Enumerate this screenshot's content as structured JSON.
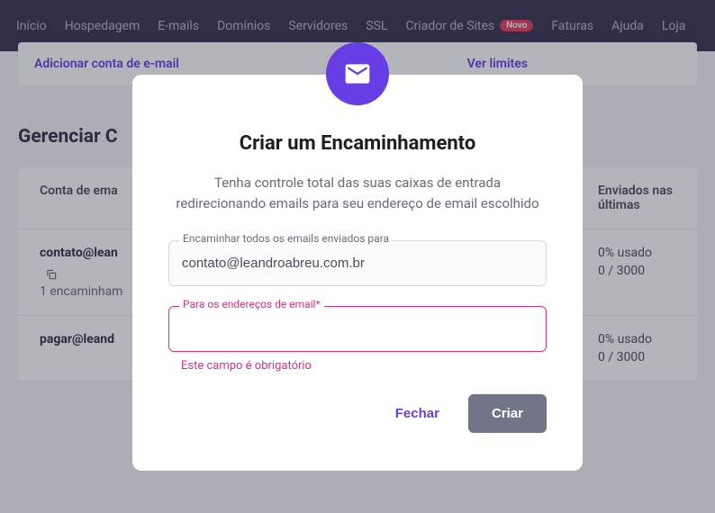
{
  "nav": {
    "items": [
      {
        "label": "Início"
      },
      {
        "label": "Hospedagem"
      },
      {
        "label": "E-mails"
      },
      {
        "label": "Domínios"
      },
      {
        "label": "Servidores"
      },
      {
        "label": "SSL"
      },
      {
        "label": "Criador de Sites",
        "badge": "Novo"
      },
      {
        "label": "Faturas"
      },
      {
        "label": "Ajuda"
      },
      {
        "label": "Loja"
      }
    ]
  },
  "bg": {
    "add_link": "Adicionar conta de e-mail",
    "limits_link": "Ver limites",
    "title": "Gerenciar C",
    "th_account": "Conta de ema",
    "th_sent": "Enviados nas últimas",
    "rows": [
      {
        "email": "contato@lean",
        "forward": "1 encaminham",
        "usage": "0% usado",
        "limit": "0 / 3000"
      },
      {
        "email": "pagar@leand",
        "forward": "",
        "usage": "0% usado",
        "limit": "0 / 3000"
      }
    ]
  },
  "modal": {
    "title": "Criar um Encaminhamento",
    "desc": "Tenha controle total das suas caixas de entrada redirecionando emails para seu endereço de email escolhido",
    "from_label": "Encaminhar todos os emails enviados para",
    "from_value": "contato@leandroabreu.com.br",
    "to_label": "Para os endereços de email*",
    "to_value": "",
    "error_msg": "Este campo é obrigatório",
    "close_btn": "Fechar",
    "create_btn": "Criar"
  }
}
